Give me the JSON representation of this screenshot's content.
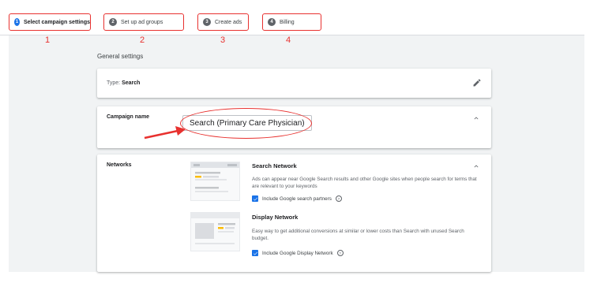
{
  "stepper": {
    "steps": [
      {
        "num": "1",
        "label": "Select campaign settings"
      },
      {
        "num": "2",
        "label": "Set up ad groups"
      },
      {
        "num": "3",
        "label": "Create ads"
      },
      {
        "num": "4",
        "label": "Billing"
      }
    ],
    "annotations": [
      "1",
      "2",
      "3",
      "4"
    ]
  },
  "main": {
    "section_title": "General settings",
    "type_card": {
      "prefix": "Type:",
      "value": "Search",
      "icon": "pencil-icon"
    },
    "name_card": {
      "label": "Campaign name",
      "value": "Search (Primary Care Physician)",
      "icon": "chevron-up-icon"
    },
    "networks_card": {
      "label": "Networks",
      "search": {
        "title": "Search Network",
        "desc": "Ads can appear near Google Search results and other Google sites when people search for terms that are relevant to your keywords",
        "checkbox_label": "Include Google search partners",
        "checked": true
      },
      "display": {
        "title": "Display Network",
        "desc": "Easy way to get additional conversions at similar or lower costs than Search with unused Search budget.",
        "checkbox_label": "Include Google Display Network",
        "checked": true
      }
    }
  },
  "colors": {
    "accent": "#1a73e8",
    "annotation": "#e8312f",
    "background": "#f1f3f4"
  }
}
